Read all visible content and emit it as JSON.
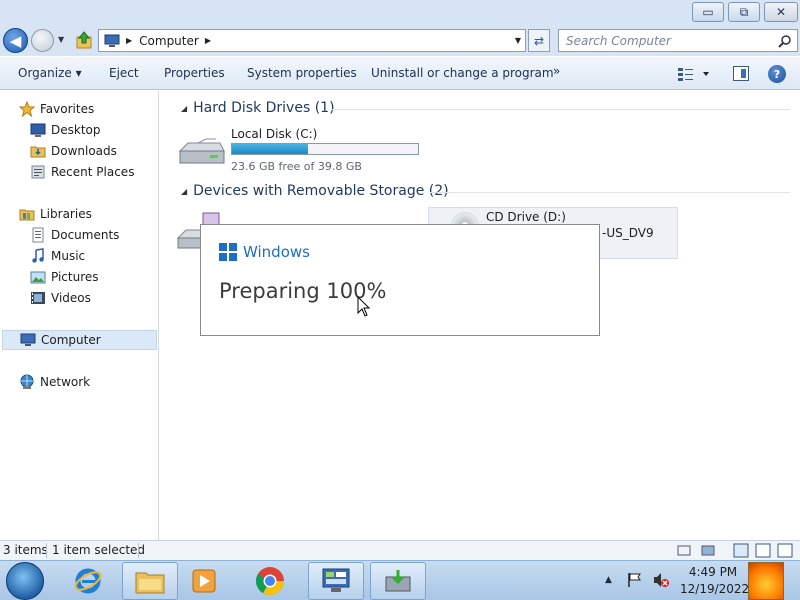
{
  "window": {
    "minimize_glyph": "▭",
    "maximize_glyph": "⧉",
    "close_glyph": "✕"
  },
  "address": {
    "path": "Computer",
    "search_placeholder": "Search Computer"
  },
  "commands": {
    "organize": "Organize ▾",
    "eject": "Eject",
    "properties": "Properties",
    "system_properties": "System properties",
    "uninstall": "Uninstall or change a program",
    "more": "»",
    "help": "?"
  },
  "nav": {
    "favorites": "Favorites",
    "desktop": "Desktop",
    "downloads": "Downloads",
    "recent_places": "Recent Places",
    "libraries": "Libraries",
    "documents": "Documents",
    "music": "Music",
    "pictures": "Pictures",
    "videos": "Videos",
    "computer": "Computer",
    "network": "Network"
  },
  "content": {
    "hdd_group": "Hard Disk Drives (1)",
    "removable_group": "Devices with Removable Storage (2)",
    "drive_c": {
      "label": "Local Disk (C:)",
      "free_text": "23.6 GB free of 39.8 GB",
      "used_fraction": 0.407
    },
    "cd_drive": {
      "label": "CD Drive (D:)",
      "volume": "-US_DV9"
    }
  },
  "dialog": {
    "brand": "Windows",
    "status": "Preparing 100%"
  },
  "statusbar": {
    "items": "3 items",
    "selected": "1 item selected"
  },
  "taskbar": {
    "time": "4:49 PM",
    "date": "12/19/2022"
  },
  "colors": {
    "accent": "#1c6fc2",
    "disk_bar": "#1d8ac6",
    "taskbar": "#b6d0ec"
  }
}
